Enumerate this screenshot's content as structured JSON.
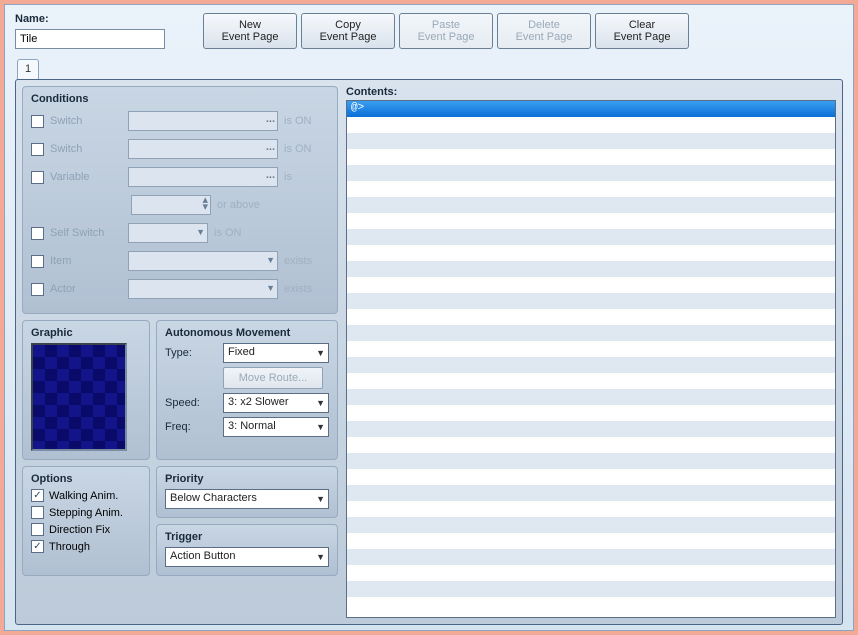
{
  "name": {
    "label": "Name:",
    "value": "Tile"
  },
  "buttons": {
    "new": {
      "l1": "New",
      "l2": "Event Page"
    },
    "copy": {
      "l1": "Copy",
      "l2": "Event Page"
    },
    "paste": {
      "l1": "Paste",
      "l2": "Event Page"
    },
    "delete": {
      "l1": "Delete",
      "l2": "Event Page"
    },
    "clear": {
      "l1": "Clear",
      "l2": "Event Page"
    }
  },
  "tab1": "1",
  "groups": {
    "conditions": "Conditions",
    "graphic": "Graphic",
    "autonomous": "Autonomous Movement",
    "options": "Options",
    "priority": "Priority",
    "trigger": "Trigger",
    "contents": "Contents:"
  },
  "cond": {
    "switch1": {
      "label": "Switch",
      "suffix": "is ON"
    },
    "switch2": {
      "label": "Switch",
      "suffix": "is ON"
    },
    "variable": {
      "label": "Variable",
      "suffix": "is",
      "suffix2": "or above"
    },
    "self": {
      "label": "Self Switch",
      "suffix": "is ON"
    },
    "item": {
      "label": "Item",
      "suffix": "exists"
    },
    "actor": {
      "label": "Actor",
      "suffix": "exists"
    }
  },
  "movement": {
    "type_label": "Type:",
    "type_value": "Fixed",
    "route_button": "Move Route...",
    "speed_label": "Speed:",
    "speed_value": "3: x2 Slower",
    "freq_label": "Freq:",
    "freq_value": "3: Normal"
  },
  "options": {
    "walking": "Walking Anim.",
    "stepping": "Stepping Anim.",
    "direction": "Direction Fix",
    "through": "Through"
  },
  "priority_value": "Below Characters",
  "trigger_value": "Action Button",
  "contents_first": "@>"
}
